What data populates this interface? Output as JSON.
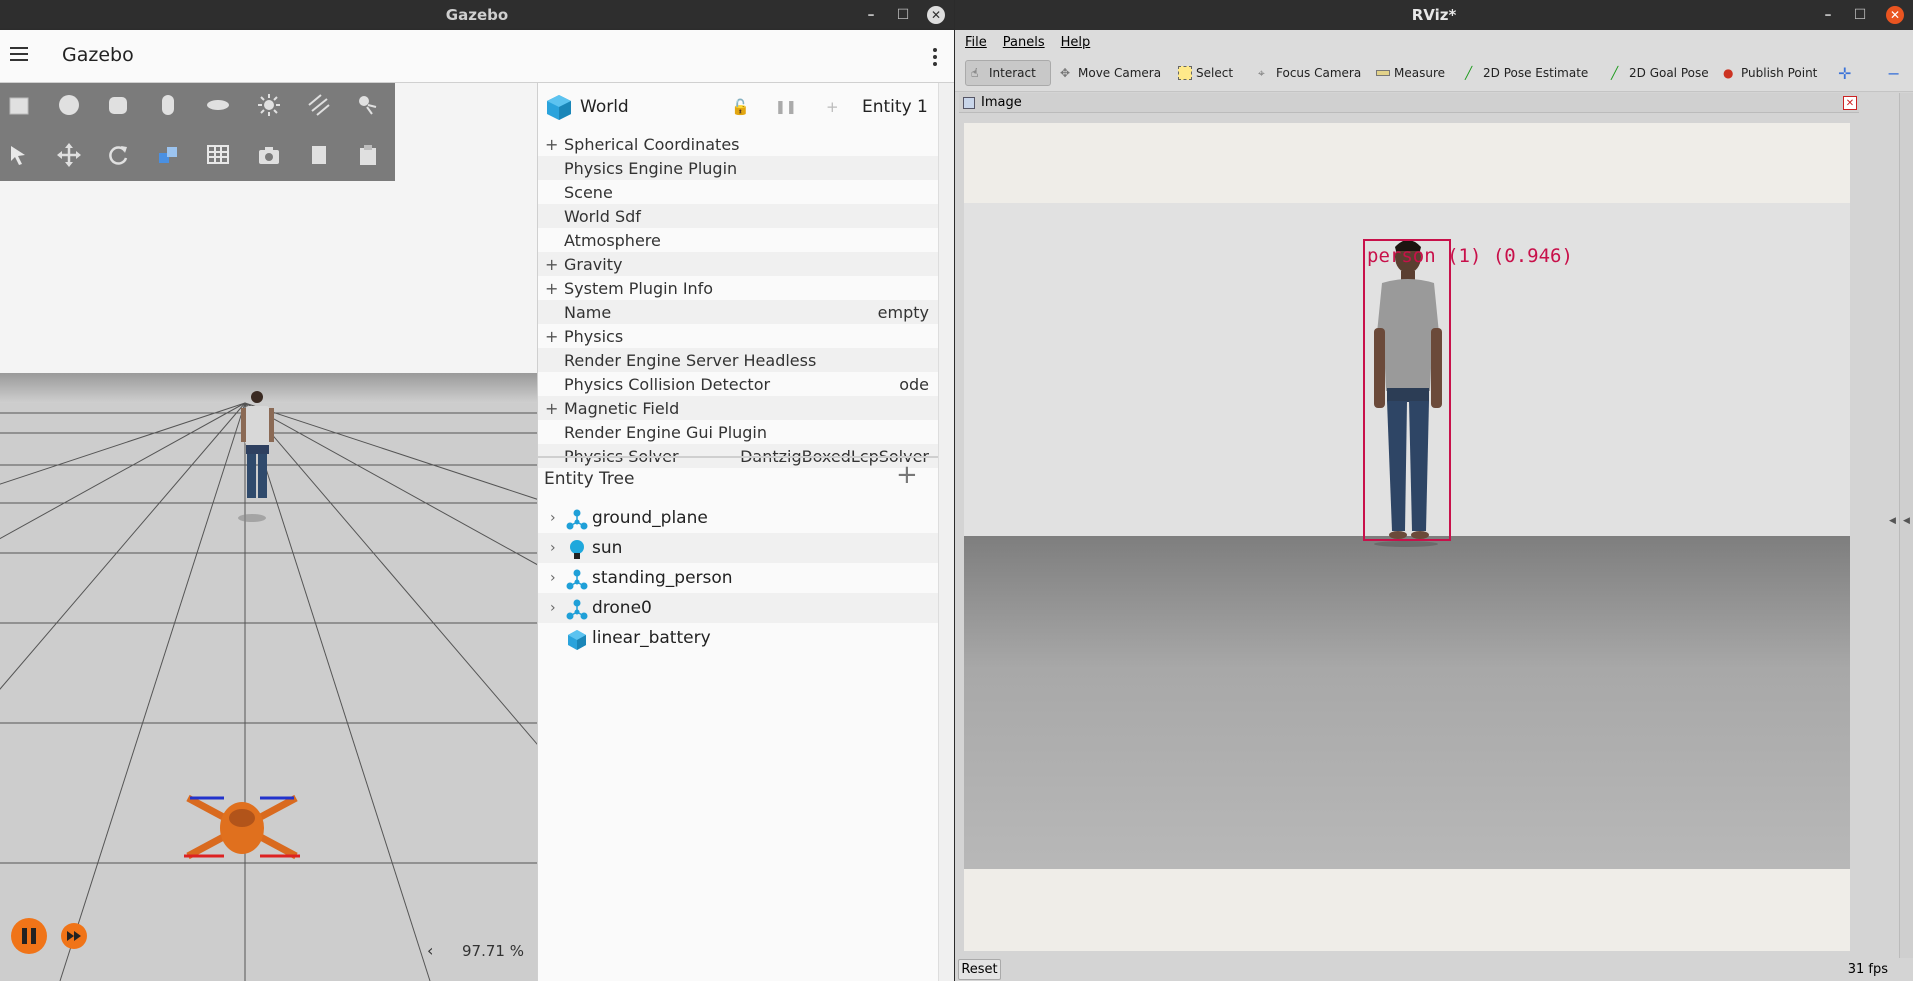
{
  "gazebo": {
    "window_title": "Gazebo",
    "app_title": "Gazebo",
    "world": {
      "title": "World",
      "entity": "Entity 1"
    },
    "properties": [
      {
        "label": "Spherical Coordinates",
        "expandable": true,
        "value": ""
      },
      {
        "label": "Physics Engine Plugin",
        "expandable": false,
        "value": ""
      },
      {
        "label": "Scene",
        "expandable": false,
        "value": ""
      },
      {
        "label": "World Sdf",
        "expandable": false,
        "value": ""
      },
      {
        "label": "Atmosphere",
        "expandable": false,
        "value": ""
      },
      {
        "label": "Gravity",
        "expandable": true,
        "value": ""
      },
      {
        "label": "System Plugin Info",
        "expandable": true,
        "value": ""
      },
      {
        "label": "Name",
        "expandable": false,
        "value": "empty"
      },
      {
        "label": "Physics",
        "expandable": true,
        "value": ""
      },
      {
        "label": "Render Engine Server Headless",
        "expandable": false,
        "value": ""
      },
      {
        "label": "Physics Collision Detector",
        "expandable": false,
        "value": "ode"
      },
      {
        "label": "Magnetic Field",
        "expandable": true,
        "value": ""
      },
      {
        "label": "Render Engine Gui Plugin",
        "expandable": false,
        "value": ""
      },
      {
        "label": "Physics Solver",
        "expandable": false,
        "value": "DantzigBoxedLcpSolver"
      }
    ],
    "entity_tree": {
      "title": "Entity Tree",
      "items": [
        {
          "name": "ground_plane",
          "icon": "model-icon",
          "expandable": true
        },
        {
          "name": "sun",
          "icon": "light-icon",
          "expandable": true
        },
        {
          "name": "standing_person",
          "icon": "model-icon",
          "expandable": true
        },
        {
          "name": "drone0",
          "icon": "model-icon",
          "expandable": true
        },
        {
          "name": "linear_battery",
          "icon": "cube-icon",
          "expandable": false
        }
      ]
    },
    "rtf": "97.71 %",
    "rtf_toggle": "‹"
  },
  "rviz": {
    "window_title": "RViz*",
    "menu": [
      "File",
      "Panels",
      "Help"
    ],
    "tools": [
      "Interact",
      "Move Camera",
      "Select",
      "Focus Camera",
      "Measure",
      "2D Pose Estimate",
      "2D Goal Pose",
      "Publish Point"
    ],
    "active_tool": "Interact",
    "image_panel_title": "Image",
    "detection_label": "person (1) (0.946)",
    "reset_label": "Reset",
    "fps": "31 fps",
    "colors": {
      "detection_box": "#c8104a",
      "accent": "#3b73d8"
    }
  }
}
